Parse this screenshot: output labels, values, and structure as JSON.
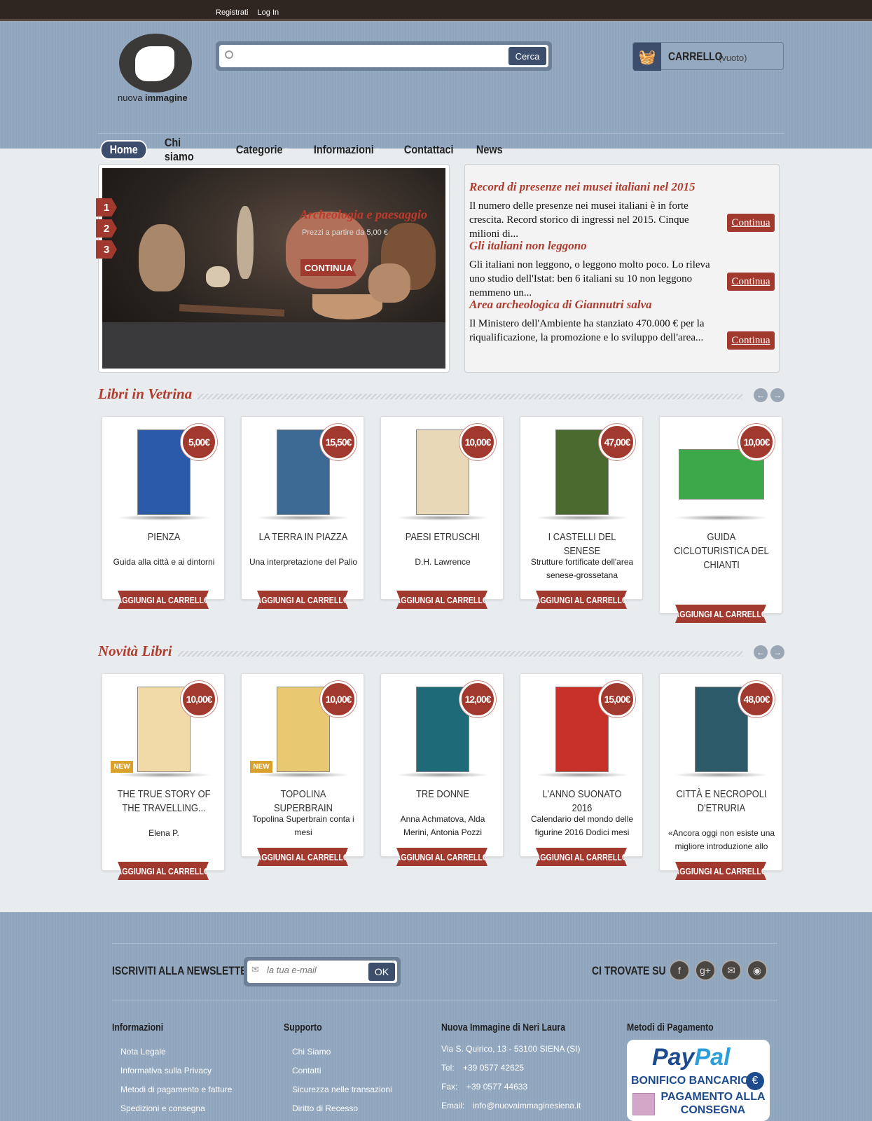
{
  "topbar": {
    "links": [
      "Registrati",
      "Log In"
    ]
  },
  "logo": {
    "text_normal": "nuova ",
    "text_bold": "immagine"
  },
  "search": {
    "placeholder": "",
    "button": "Cerca"
  },
  "cart": {
    "label": "CARRELLO",
    "status": "(vuoto)"
  },
  "nav": {
    "items": [
      "Home",
      "Chi siamo",
      "Categorie",
      "Informazioni",
      "Contattaci",
      "News"
    ]
  },
  "slider": {
    "tabs": [
      "1",
      "2",
      "3"
    ],
    "title": "Archeologia e paesaggio",
    "subtitle": "Prezzi a partire da 5,00 €",
    "button": "CONTINUA"
  },
  "news": [
    {
      "title": "Record di presenze nei musei italiani nel 2015",
      "text": "Il numero delle presenze nei musei italiani è in forte crescita. Record storico di ingressi nel 2015. Cinque milioni di...",
      "more": "Continua"
    },
    {
      "title": "Gli italiani non leggono",
      "text": "Gli italiani non leggono, o leggono molto poco. Lo rileva uno studio dell'Istat: ben 6 italiani su 10 non leggono nemmeno un...",
      "more": "Continua"
    },
    {
      "title": "Area archeologica di Giannutri salva",
      "text": "Il Ministero dell'Ambiente ha stanziato 470.000 € per la riqualificazione, la promozione e lo sviluppo dell'area...",
      "more": "Continua"
    }
  ],
  "vetrina": {
    "title": "Libri in Vetrina",
    "books": [
      {
        "name": "PIENZA",
        "desc": "Guida alla città e ai dintorni",
        "price": "5,00€",
        "cover_color": "#2a5aa8",
        "button": "AGGIUNGI AL CARRELLO"
      },
      {
        "name": "LA TERRA IN PIAZZA",
        "desc": "Una interpretazione del Palio",
        "price": "15,50€",
        "cover_color": "#3c6a94",
        "button": "AGGIUNGI AL CARRELLO"
      },
      {
        "name": "PAESI ETRUSCHI",
        "desc": "D.H. Lawrence",
        "price": "10,00€",
        "cover_color": "#e8d8b8",
        "button": "AGGIUNGI AL CARRELLO"
      },
      {
        "name": "I CASTELLI DEL SENESE",
        "desc": "Strutture fortificate dell'area senese-grossetana",
        "price": "47,00€",
        "cover_color": "#4a6a30",
        "button": "AGGIUNGI AL CARRELLO"
      },
      {
        "name": "GUIDA CICLOTURISTICA DEL CHIANTI",
        "desc": "",
        "price": "10,00€",
        "cover_color": "#3ca84a",
        "button": "AGGIUNGI AL CARRELLO"
      }
    ]
  },
  "novita": {
    "title": "Novità Libri",
    "books": [
      {
        "name": "THE TRUE STORY OF THE TRAVELLING...",
        "desc": "Elena P.",
        "price": "10,00€",
        "cover_color": "#f2d9a8",
        "badge": "NEW",
        "button": "AGGIUNGI AL CARRELLO"
      },
      {
        "name": "TOPOLINA SUPERBRAIN",
        "desc": "Topolina Superbrain conta i mesi",
        "price": "10,00€",
        "cover_color": "#e8c870",
        "badge": "NEW",
        "button": "AGGIUNGI AL CARRELLO"
      },
      {
        "name": "TRE DONNE",
        "desc": "Anna Achmatova, Alda Merini, Antonia Pozzi",
        "price": "12,00€",
        "cover_color": "#1e6a78",
        "badge": "",
        "button": "AGGIUNGI AL CARRELLO"
      },
      {
        "name": "L'ANNO SUONATO 2016",
        "desc": "Calendario del mondo delle figurine 2016  Dodici mesi",
        "price": "15,00€",
        "cover_color": "#c8302a",
        "badge": "",
        "button": "AGGIUNGI AL CARRELLO"
      },
      {
        "name": "CITTÀ E NECROPOLI D'ETRURIA",
        "desc": "«Ancora oggi non esiste una migliore introduzione allo",
        "price": "48,00€",
        "cover_color": "#2c5a68",
        "badge": "",
        "button": "AGGIUNGI AL CARRELLO"
      }
    ]
  },
  "footer": {
    "newsletter_label": "ISCRIVITI ALLA NEWSLETTER",
    "newsletter_placeholder": "la tua e-mail",
    "newsletter_button": "OK",
    "social_label": "CI TROVATE SU",
    "social": [
      "f",
      "g+",
      "✉",
      "◉"
    ],
    "col1": {
      "title": "Informazioni",
      "links": [
        "Nota Legale",
        "Informativa sulla Privacy",
        "Metodi di pagamento e fatture",
        "Spedizioni e consegna"
      ]
    },
    "col2": {
      "title": "Supporto",
      "links": [
        "Chi Siamo",
        "Contatti",
        "Sicurezza nelle transazioni",
        "Diritto di Recesso"
      ]
    },
    "col3": {
      "title": "Nuova Immagine di Neri Laura",
      "address": "Via S. Quirico, 13 - 53100 SIENA   (SI)",
      "tel_label": "Tel:",
      "tel": "+39 0577 42625",
      "fax_label": "Fax:",
      "fax": "+39 0577 44633",
      "email_label": "Email:",
      "email": "info@nuovaimmaginesiena.it"
    },
    "col4": {
      "title": "Metodi di Pagamento",
      "paypal_a": "Pay",
      "paypal_b": "Pal",
      "bonifico": "BONIFICO BANCARIO",
      "euro": "€",
      "pagamento": "PAGAMENTO ALLA CONSEGNA"
    }
  }
}
